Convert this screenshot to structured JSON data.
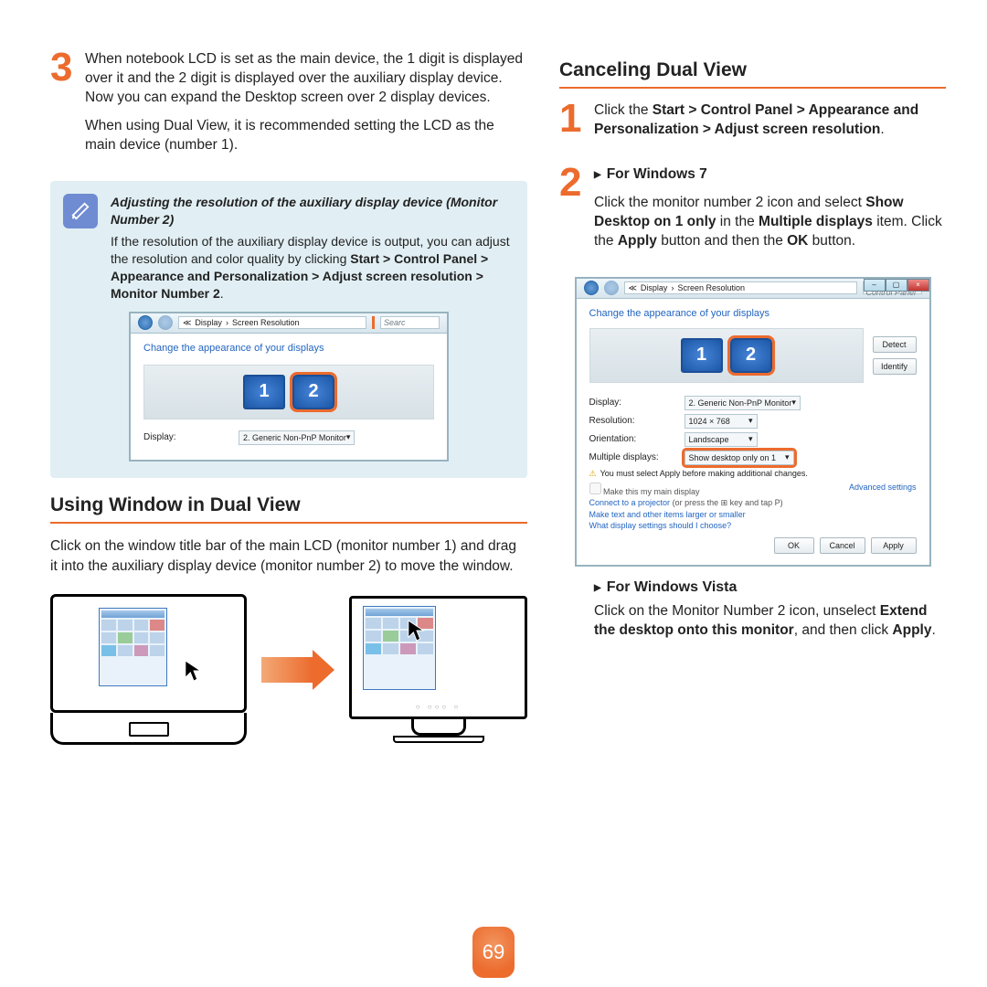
{
  "page_number": "69",
  "left": {
    "step3": {
      "num": "3",
      "p1": "When notebook LCD is set as the main device, the 1 digit is displayed over it and the 2 digit is displayed over the auxiliary display device. Now you can expand the Desktop screen over 2 display devices.",
      "p2": "When using Dual View, it is recommended setting the LCD as the main device (number 1)."
    },
    "tip": {
      "title": "Adjusting the resolution of the auxiliary display device (Monitor Number 2)",
      "body_a": "If the resolution of the auxiliary display device is output, you can adjust the resolution and color quality by clicking ",
      "body_b": "Start > Control Panel > Appearance and Personalization > Adjust screen resolution > Monitor Number 2",
      "body_c": "."
    },
    "shot": {
      "crumb_a": "≪",
      "crumb_b": "Display",
      "crumb_sep": "›",
      "crumb_c": "Screen Resolution",
      "search": "Searc",
      "heading": "Change the appearance of your displays",
      "display_label": "Display:",
      "display_value": "2. Generic Non-PnP Monitor"
    },
    "section2_title": "Using Window in Dual View",
    "section2_body": "Click on the window title bar of the main LCD (monitor number 1) and drag it into the auxiliary display device (monitor number 2) to move the window."
  },
  "right": {
    "section_title": "Canceling Dual View",
    "step1": {
      "num": "1",
      "a": "Click the ",
      "b": "Start > Control Panel > Appearance and Personalization > Adjust screen resolution",
      "c": "."
    },
    "step2": {
      "num": "2",
      "win7_title": "For Windows 7",
      "win7_a": "Click the monitor number 2 icon and select ",
      "win7_b": "Show Desktop on 1 only",
      "win7_c": " in the ",
      "win7_d": "Multiple displays",
      "win7_e": " item. Click the ",
      "win7_f": "Apply",
      "win7_g": " button and then the ",
      "win7_h": "OK",
      "win7_i": " button."
    },
    "shot": {
      "crumb_a": "≪",
      "crumb_b": "Display",
      "crumb_sep": "›",
      "crumb_c": "Screen Resolution",
      "search_ph": "Search Control Panel",
      "heading": "Change the appearance of your displays",
      "detect": "Detect",
      "identify": "Identify",
      "display_label": "Display:",
      "display_value": "2. Generic Non-PnP Monitor",
      "res_label": "Resolution:",
      "res_value": "1024 × 768",
      "ori_label": "Orientation:",
      "ori_value": "Landscape",
      "multi_label": "Multiple displays:",
      "multi_value": "Show desktop only on 1",
      "warn": "You must select Apply before making additional changes.",
      "make_main": "Make this my main display",
      "adv": "Advanced settings",
      "projector_a": "Connect to a projector",
      "projector_b": " (or press the ⊞ key and tap P)",
      "text_larger": "Make text and other items larger or smaller",
      "what_settings": "What display settings should I choose?",
      "ok": "OK",
      "cancel": "Cancel",
      "apply": "Apply"
    },
    "vista": {
      "title": "For Windows Vista",
      "a": "Click on the Monitor Number 2 icon, unselect ",
      "b": "Extend the desktop onto this monitor",
      "c": ", and then click ",
      "d": "Apply",
      "e": "."
    }
  }
}
